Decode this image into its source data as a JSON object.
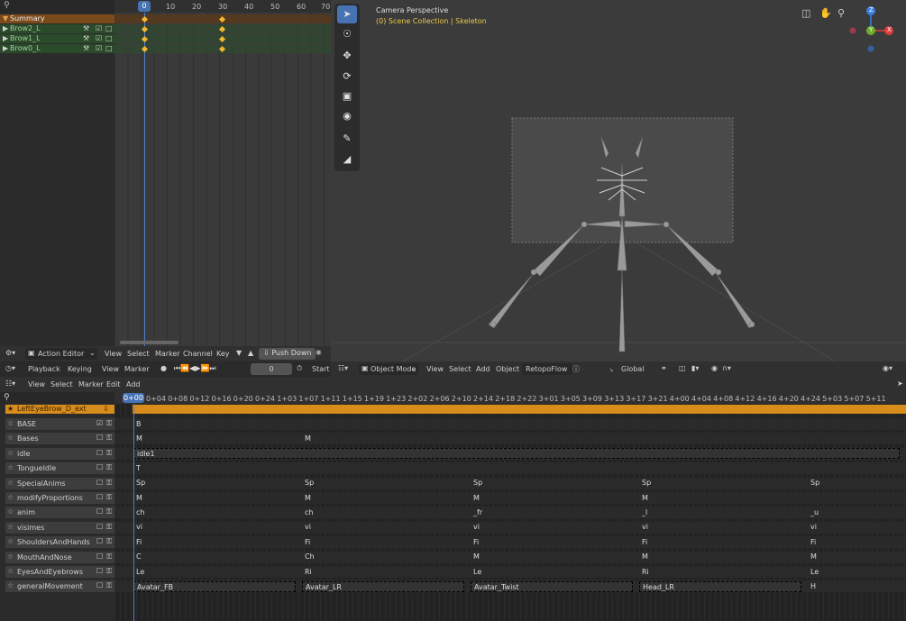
{
  "dopesheet": {
    "search_placeholder": "",
    "current_frame": "0",
    "ruler": [
      "10",
      "20",
      "30",
      "40",
      "50",
      "60",
      "70"
    ],
    "summary": "Summary",
    "channels": [
      "Brow2_L",
      "Brow1_L",
      "Brow0_L"
    ],
    "footer": {
      "mode": "Action Editor",
      "menus": [
        "View",
        "Select",
        "Marker",
        "Channel",
        "Key"
      ],
      "push_down": "Push Down"
    }
  },
  "timeline": {
    "menus": [
      "Playback",
      "Keying",
      "View",
      "Marker"
    ],
    "frame": "0",
    "start": "Start"
  },
  "viewport": {
    "title": "Camera Perspective",
    "subtitle": "(0) Scene Collection | Skeleton",
    "footer": {
      "mode": "Object Mode",
      "menus": [
        "View",
        "Select",
        "Add",
        "Object"
      ],
      "retopo": "RetopoFlow",
      "transform": "Global"
    },
    "gizmo": {
      "z": "Z",
      "y": "Y",
      "x": "X"
    }
  },
  "nla": {
    "menus": [
      "View",
      "Select",
      "Marker",
      "Edit",
      "Add"
    ],
    "current": "0+00",
    "ruler": [
      "0+04",
      "0+08",
      "0+12",
      "0+16",
      "0+20",
      "0+24",
      "1+03",
      "1+07",
      "1+11",
      "1+15",
      "1+19",
      "1+23",
      "2+02",
      "2+06",
      "2+10",
      "2+14",
      "2+18",
      "2+22",
      "3+01",
      "3+05",
      "3+09",
      "3+13",
      "3+17",
      "3+21",
      "4+00",
      "4+04",
      "4+08",
      "4+12",
      "4+16",
      "4+20",
      "4+24",
      "5+03",
      "5+07",
      "5+11"
    ],
    "active_action": "LeftEyeBrow_D_ext",
    "tracks": [
      {
        "name": "BASE",
        "strips": [
          "B"
        ]
      },
      {
        "name": "Bases",
        "strips": [
          "M",
          "M"
        ]
      },
      {
        "name": "idle",
        "strips": [
          "idle1"
        ]
      },
      {
        "name": "TongueIdle",
        "strips": [
          "T"
        ]
      },
      {
        "name": "SpecialAnims",
        "strips": [
          "Sp",
          "Sp",
          "Sp",
          "Sp",
          "Sp"
        ]
      },
      {
        "name": "modifyProportions",
        "strips": [
          "M",
          "M",
          "M",
          "M"
        ]
      },
      {
        "name": "anim",
        "strips": [
          "ch",
          "ch",
          "_fr",
          "_l",
          "_u"
        ]
      },
      {
        "name": "visimes",
        "strips": [
          "vi",
          "vi",
          "vi",
          "vi",
          "vi"
        ]
      },
      {
        "name": "ShouldersAndHands",
        "strips": [
          "Fi",
          "Fi",
          "Fi",
          "Fi",
          "Fi"
        ]
      },
      {
        "name": "MouthAndNose",
        "strips": [
          "C",
          "Ch",
          "M",
          "M",
          "M"
        ]
      },
      {
        "name": "EyesAndEyebrows",
        "strips": [
          "Le",
          "Ri",
          "Le",
          "Ri",
          "Le"
        ]
      },
      {
        "name": "generalMovement",
        "strips": [
          "Avatar_FB",
          "Avatar_LR",
          "Avatar_Twist",
          "Head_LR",
          "H"
        ]
      }
    ]
  },
  "colors": {
    "accent": "#4772b3",
    "orange": "#d78c1b",
    "key": "#f2b631"
  }
}
